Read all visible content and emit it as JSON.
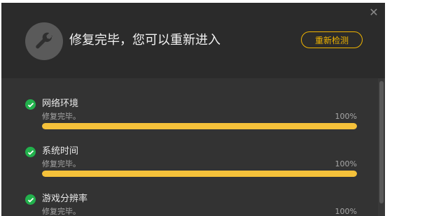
{
  "header": {
    "title": "修复完毕，您可以重新进入",
    "recheck_label": "重新检测",
    "close_icon": "close-icon",
    "wrench_icon": "wrench-icon"
  },
  "items": [
    {
      "title": "网络环境",
      "status": "修复完毕。",
      "percent": "100%",
      "progress": 1.0
    },
    {
      "title": "系统时间",
      "status": "修复完毕。",
      "percent": "100%",
      "progress": 1.0
    },
    {
      "title": "游戏分辨率",
      "status": "修复完毕。",
      "percent": "100%",
      "progress": 1.0
    }
  ],
  "colors": {
    "accent": "#f0b400",
    "progress": "#f5c13a",
    "check": "#22b14c"
  }
}
